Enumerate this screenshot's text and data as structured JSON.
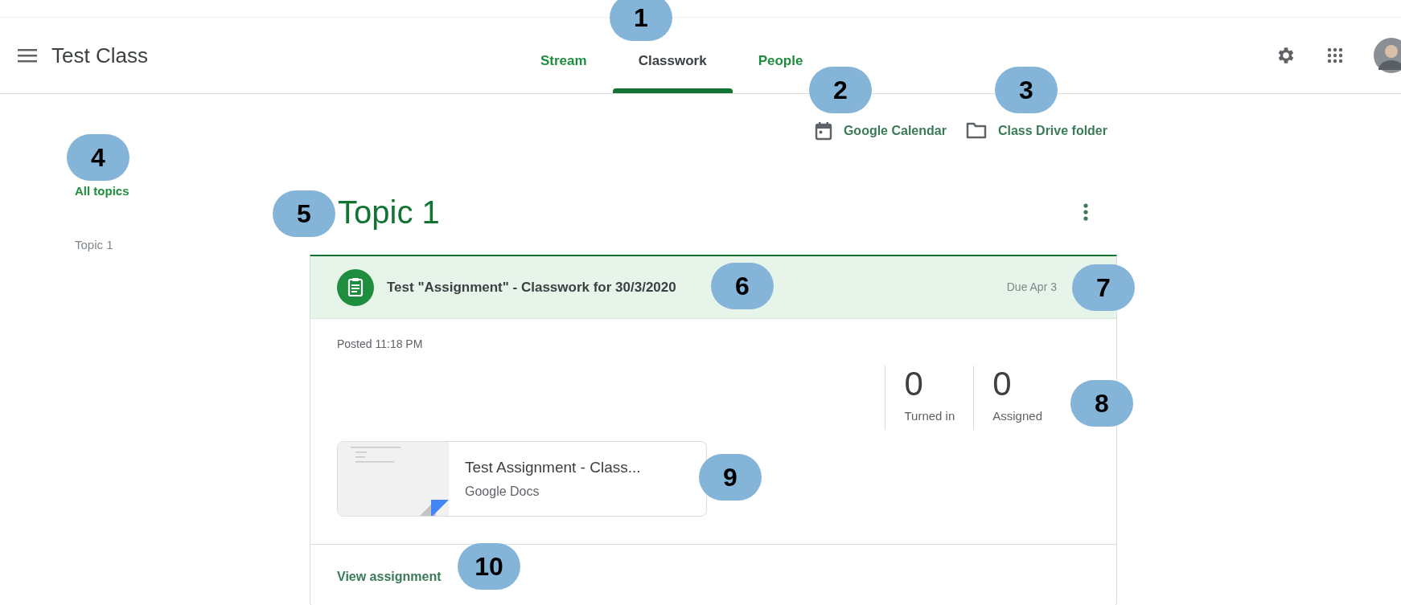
{
  "header": {
    "title": "Test Class"
  },
  "tabs": [
    {
      "label": "Stream",
      "selected": false
    },
    {
      "label": "Classwork",
      "selected": true
    },
    {
      "label": "People",
      "selected": false
    }
  ],
  "links": [
    {
      "kind": "calendar",
      "label": "Google Calendar"
    },
    {
      "kind": "folder",
      "label": "Class Drive folder"
    }
  ],
  "sidebar": {
    "items": [
      {
        "label": "All topics",
        "selected": true
      },
      {
        "label": "Topic 1",
        "selected": false
      }
    ]
  },
  "topic": {
    "title": "Topic 1",
    "assignment": {
      "title": "Test \"Assignment\" - Classwork for 30/3/2020",
      "due": "Due Apr 3",
      "posted": "Posted 11:18 PM",
      "stats": [
        {
          "value": "0",
          "label": "Turned in"
        },
        {
          "value": "0",
          "label": "Assigned"
        }
      ],
      "attachment": {
        "title": "Test Assignment - Class...",
        "type": "Google Docs"
      },
      "action": "View assignment"
    }
  },
  "callouts": [
    {
      "label": "1"
    },
    {
      "label": "2"
    },
    {
      "label": "3"
    },
    {
      "label": "4"
    },
    {
      "label": "5"
    },
    {
      "label": "6"
    },
    {
      "label": "7"
    },
    {
      "label": "8"
    },
    {
      "label": "9"
    },
    {
      "label": "10"
    }
  ]
}
